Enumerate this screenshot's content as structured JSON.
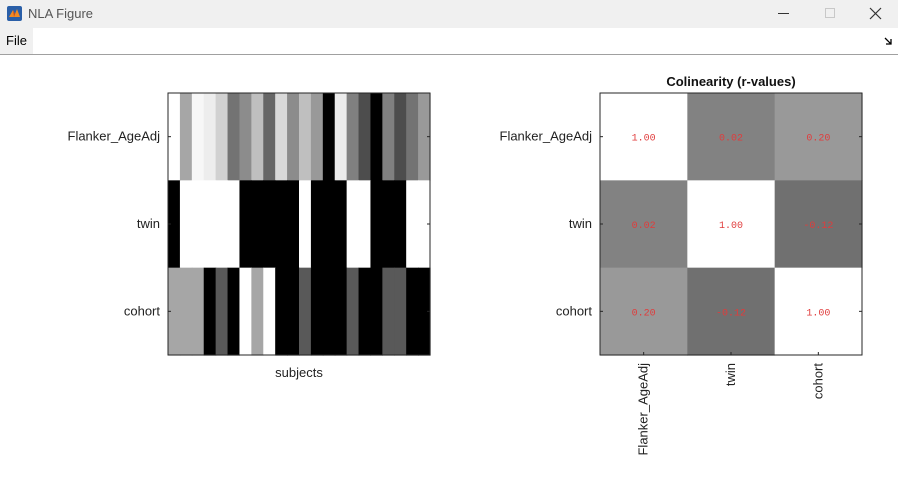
{
  "window": {
    "title": "NLA Figure",
    "icon": "matlab-icon"
  },
  "menu": {
    "items": [
      "File"
    ],
    "dock_icon": "dock-arrow-icon"
  },
  "left_plot": {
    "rows": [
      "Flanker_AgeAdj",
      "twin",
      "cohort"
    ],
    "xlabel": "subjects",
    "cells": [
      [
        1.0,
        0.65,
        0.97,
        0.93,
        0.82,
        0.45,
        0.55,
        0.75,
        0.4,
        0.85,
        0.55,
        0.75,
        0.6,
        0.0,
        0.92,
        0.5,
        0.3,
        0.0,
        0.5,
        0.3,
        0.45,
        0.6
      ],
      [
        0,
        1,
        1,
        1,
        1,
        1,
        0,
        0,
        0,
        0,
        0,
        1,
        0,
        0,
        0,
        1,
        1,
        0,
        0,
        0,
        1,
        1
      ],
      [
        0.65,
        0.65,
        0.65,
        0.0,
        0.35,
        0.0,
        1.0,
        0.65,
        1.0,
        0.0,
        0.0,
        0.35,
        0.0,
        0.0,
        0.0,
        0.35,
        0.0,
        0.0,
        0.35,
        0.35,
        0.0,
        0.0
      ]
    ]
  },
  "chart_data": {
    "type": "heatmap",
    "title": "Colinearity (r-values)",
    "rows": [
      "Flanker_AgeAdj",
      "twin",
      "cohort"
    ],
    "columns": [
      "Flanker_AgeAdj",
      "twin",
      "cohort"
    ],
    "values": [
      [
        1.0,
        0.02,
        0.2
      ],
      [
        0.02,
        1.0,
        -0.12
      ],
      [
        0.2,
        -0.12,
        1.0
      ]
    ],
    "labels": [
      [
        "1.00",
        "0.02",
        "0.20"
      ],
      [
        "0.02",
        "1.00",
        "-0.12"
      ],
      [
        "0.20",
        "-0.12",
        "1.00"
      ]
    ],
    "colormap": "gray",
    "text_color": "#e03c3c"
  }
}
